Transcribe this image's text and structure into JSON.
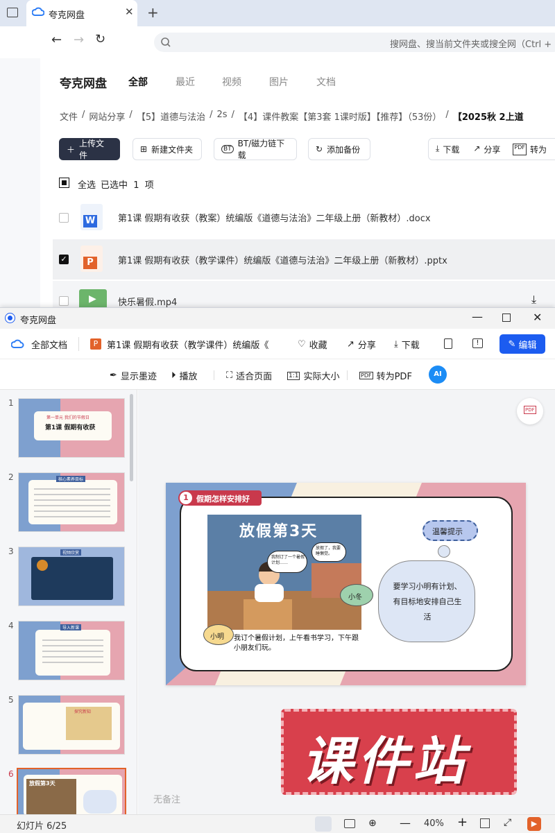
{
  "browser": {
    "tab_title": "夸克网盘",
    "search_placeholder": "搜网盘、搜当前文件夹或搜全网（Ctrl + F）"
  },
  "cloud": {
    "app_title": "夸克网盘",
    "tabs": [
      "全部",
      "最近",
      "视频",
      "图片",
      "文档"
    ],
    "breadcrumb": [
      "文件",
      "网站分享",
      "【5】道德与法治",
      "2s",
      "【4】课件教案【第3套 1课时版】【推荐】（53份）",
      "【2025秋 2上道"
    ],
    "toolbar": {
      "upload": "上传文件",
      "new_folder": "新建文件夹",
      "bt": "BT/磁力链下载",
      "backup": "添加备份",
      "download": "下载",
      "share": "分享",
      "convert": "转为"
    },
    "select_all": "全选",
    "selected_info": "已选中  1  项",
    "files": [
      {
        "name": "第1课 假期有收获（教案）统编版《道德与法治》二年级上册（新教材）.docx",
        "type": "word",
        "checked": false
      },
      {
        "name": "第1课 假期有收获（教学课件）统编版《道德与法治》二年级上册（新教材）.pptx",
        "type": "ppt",
        "checked": true
      },
      {
        "name": "快乐暑假.mp4",
        "type": "video",
        "checked": false
      }
    ]
  },
  "viewer": {
    "window_title": "夸克网盘",
    "all_docs": "全部文档",
    "doc_title": "第1课 假期有收获（教学课件）统编版《",
    "favorite": "收藏",
    "share": "分享",
    "download": "下载",
    "edit": "编辑",
    "tools": {
      "ink": "显示墨迹",
      "play": "播放",
      "fit_page": "适合页面",
      "actual_size": "实际大小",
      "to_pdf": "转为PDF"
    },
    "thumbnails": [
      {
        "num": "1",
        "title": "第1课 假期有收获",
        "header": "第一单元  我们的节假日"
      },
      {
        "num": "2",
        "title": "核心素养目标"
      },
      {
        "num": "3",
        "title": "视频欣赏"
      },
      {
        "num": "4",
        "title": "导入新课"
      },
      {
        "num": "5",
        "title": "探究新知"
      },
      {
        "num": "6",
        "title": "放假第3天"
      }
    ],
    "slide": {
      "section_num": "1",
      "section_title": "假期怎样安排好",
      "image_title": "放假第3天",
      "bubble1": "我制订了一个暑假计划……",
      "bubble2": "放假了，我要睡懒觉。",
      "name_xiaodong": "小冬",
      "name_xiaoming": "小明",
      "caption": "我订个暑假计划，上午看书学习，下午跟小朋友们玩。",
      "tip_title": "温馨提示",
      "tip_text": "要学习小明有计划、有目标地安排自己生活"
    },
    "watermark": "课件站",
    "no_notes": "无备注",
    "status_slide": "幻灯片 6/25",
    "zoom": "40%"
  },
  "colors": {
    "accent": "#1c5cf0",
    "dark_button": "#2b3245",
    "slide_red": "#c9394c",
    "slide_blue": "#7ea0cf",
    "slide_pink": "#e6a5b0",
    "watermark_red": "#d8404c"
  }
}
